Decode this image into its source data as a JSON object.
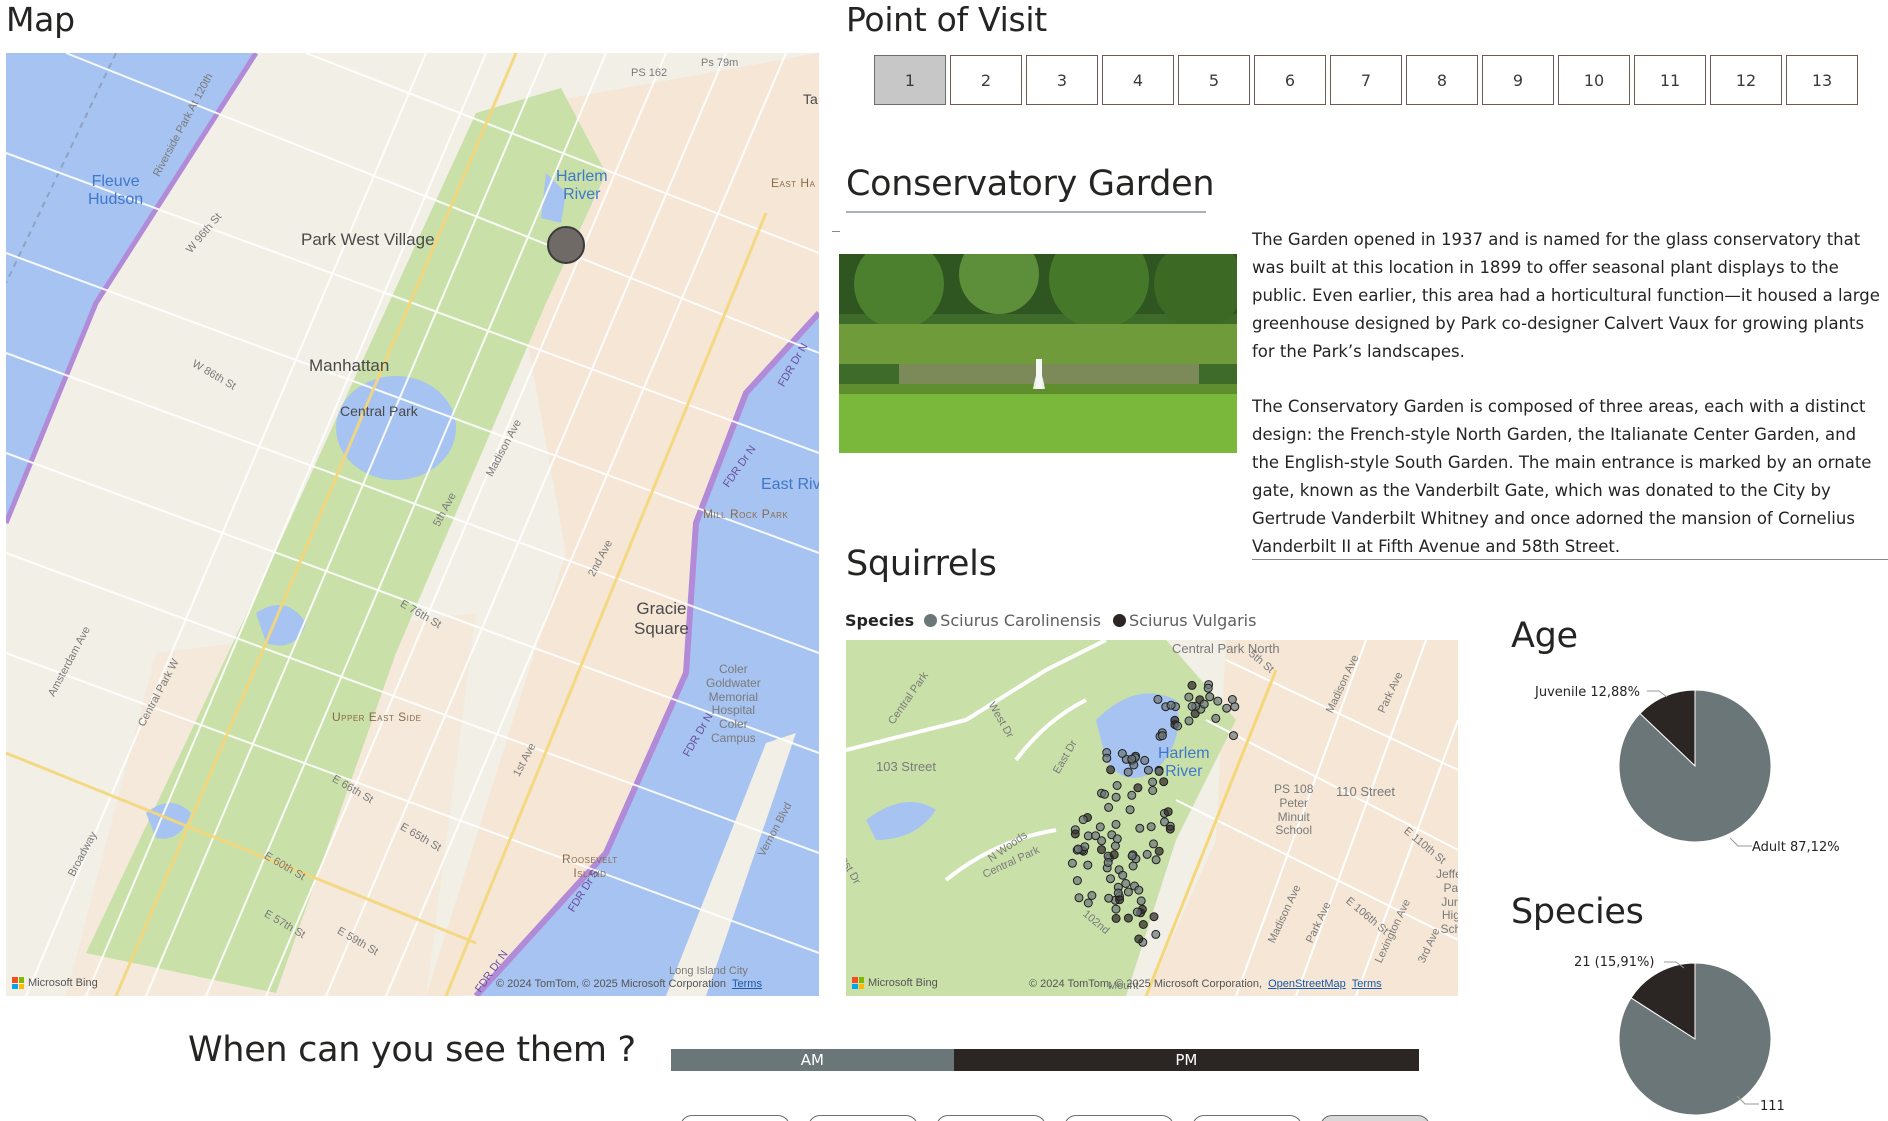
{
  "map_panel": {
    "title": "Map",
    "labels": {
      "fleuve_hudson": "Fleuve\nHudson",
      "park_west_village": "Park West Village",
      "manhattan": "Manhattan",
      "central_park": "Central Park",
      "harlem_river": "Harlem\nRiver",
      "east_river": "East Riv",
      "mill_rock_park": "Mill Rock Park",
      "gracie_square": "Gracie\nSquare",
      "upper_east_side": "Upper East Side",
      "roosevelt_island": "Roosevelt\nIsland",
      "coler": "Coler\nGoldwater\nMemorial\nHospital\nColer\nCampus",
      "ps162": "PS 162",
      "ps79m": "Ps 79m",
      "east_ha": "East Ha",
      "ta": "Ta",
      "riverside": "Riverside Park At 120th",
      "fdr1": "FDR Dr N",
      "fdr2": "FDR Dr S",
      "fdr3": "FDR Dr N",
      "fdr4": "FDR Dr N",
      "fdr5": "FDR Dr N",
      "long_island_city": "Long Island City",
      "street_w96": "W 96th St",
      "street_w86": "W 86th St",
      "street_e76": "E 76th St",
      "street_e66": "E 66th St",
      "street_e65": "E 65th St",
      "street_e60": "E 60th St",
      "street_e57": "E 57th St",
      "street_e59": "E 59th St",
      "street_5th": "5th Ave",
      "street_madison": "Madison Ave",
      "street_2nd": "2nd Ave",
      "street_1st": "1st Ave",
      "street_amsterdam": "Amsterdam Ave",
      "street_cpw": "Central Park W",
      "street_broadway": "Broadway",
      "street_vernon": "Vernon Blvd"
    },
    "attribution": "© 2024 TomTom, © 2025 Microsoft Corporation",
    "terms": "Terms",
    "bing": "Microsoft Bing"
  },
  "visit": {
    "title": "Point of Visit",
    "buttons": [
      "1",
      "2",
      "3",
      "4",
      "5",
      "6",
      "7",
      "8",
      "9",
      "10",
      "11",
      "12",
      "13"
    ],
    "selected": "1"
  },
  "place": {
    "name": "Conservatory Garden",
    "description_1": "The Garden opened in 1937 and is named for the glass conservatory that was built at this location in 1899 to offer seasonal plant displays to the public. Even earlier, this area had a horticultural function—it housed a large greenhouse designed by Park co-designer Calvert Vaux for growing plants for the Park’s landscapes.",
    "description_2": "The Conservatory Garden is composed of three areas, each with a distinct design: the French-style North Garden, the Italianate Center Garden, and the English-style South Garden. The main entrance is marked by an ornate gate, known as the Vanderbilt Gate, which was donated to the City by Gertrude Vanderbilt Whitney and once adorned the mansion of Cornelius Vanderbilt II at Fifth Avenue and 58th Street."
  },
  "squirrels": {
    "title": "Squirrels",
    "legend_title": "Species",
    "legend": [
      {
        "name": "Sciurus Carolinensis",
        "color": "#6b7679"
      },
      {
        "name": "Sciurus Vulgaris",
        "color": "#2b2523"
      }
    ],
    "map_labels": {
      "central_park_north": "Central Park North",
      "harlem_river": "Harlem\nRiver",
      "street_103": "103 Street",
      "street_110": "110 Street",
      "ps108": "PS 108\nPeter\nMinuit\nSchool",
      "jefferson": "Jeffer\nPa\nJun\nHig\nSch",
      "central_park_w": "Central Park",
      "west_dr": "West Dr",
      "east_dr": "East Dr",
      "n_woods": "N Woods",
      "central_park2": "Central Park",
      "madison": "Madison Ave",
      "park_ave": "Park Ave",
      "lexington": "Lexington Ave",
      "third": "3rd Ave",
      "e110": "E 110th St",
      "e106": "E 106th St",
      "madison2": "Madison Ave",
      "park_ave2": "Park Ave",
      "fifth_st": "5th St",
      "w_dr": "est Dr",
      "nd_102": "102nd",
      "mount": "Mount"
    },
    "attribution": "© 2024 TomTom, © 2025 Microsoft Corporation,",
    "osm": "OpenStreetMap",
    "terms": "Terms",
    "bing": "Microsoft Bing"
  },
  "age": {
    "title": "Age",
    "chart_data": {
      "type": "pie",
      "slices": [
        {
          "label": "Adult",
          "value": 87.12,
          "display": "Adult 87,12%",
          "color": "#6b7679"
        },
        {
          "label": "Juvenile",
          "value": 12.88,
          "display": "Juvenile 12,88%",
          "color": "#2b2523"
        }
      ]
    }
  },
  "species": {
    "title": "Species",
    "chart_data": {
      "type": "pie",
      "slices": [
        {
          "label": "Sciurus Carolinensis",
          "value": 111,
          "display": "111",
          "color": "#6b7679"
        },
        {
          "label": "Sciurus Vulgaris",
          "value": 21,
          "display": "21 (15,91%)",
          "color": "#2b2523"
        }
      ]
    }
  },
  "when": {
    "title": "When can you see them ?",
    "am_label": "AM",
    "pm_label": "PM",
    "am_share": 0.378,
    "am_color": "#6b7679",
    "pm_color": "#2b2523"
  },
  "chart_data": [
    {
      "type": "pie",
      "title": "Age",
      "categories": [
        "Adult",
        "Juvenile"
      ],
      "values": [
        87.12,
        12.88
      ]
    },
    {
      "type": "pie",
      "title": "Species",
      "categories": [
        "Sciurus Carolinensis",
        "Sciurus Vulgaris"
      ],
      "values": [
        111,
        21
      ]
    }
  ]
}
